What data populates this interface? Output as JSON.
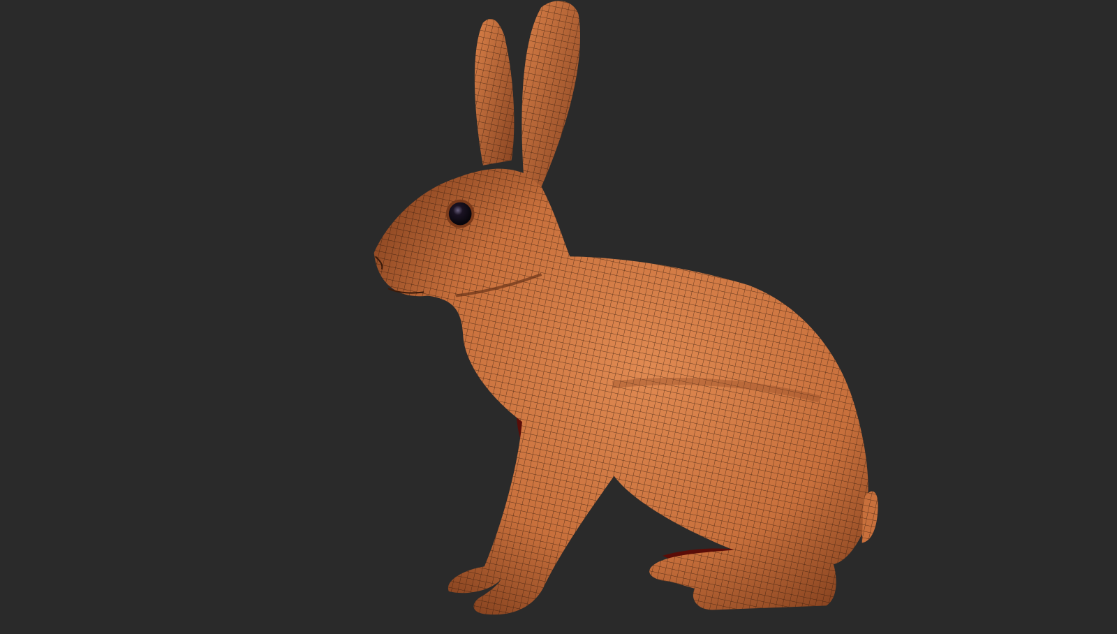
{
  "scene": {
    "subject": "rabbit",
    "render_style": "quad wireframe over shaded clay",
    "colors": {
      "background": "#2a2a2a",
      "skin_light": "#e08a52",
      "skin_mid": "#c8703c",
      "skin_dark": "#7a3a1a",
      "wire": "#2b160a",
      "eye": "#120c18",
      "cavity": "#5a0d08"
    }
  }
}
